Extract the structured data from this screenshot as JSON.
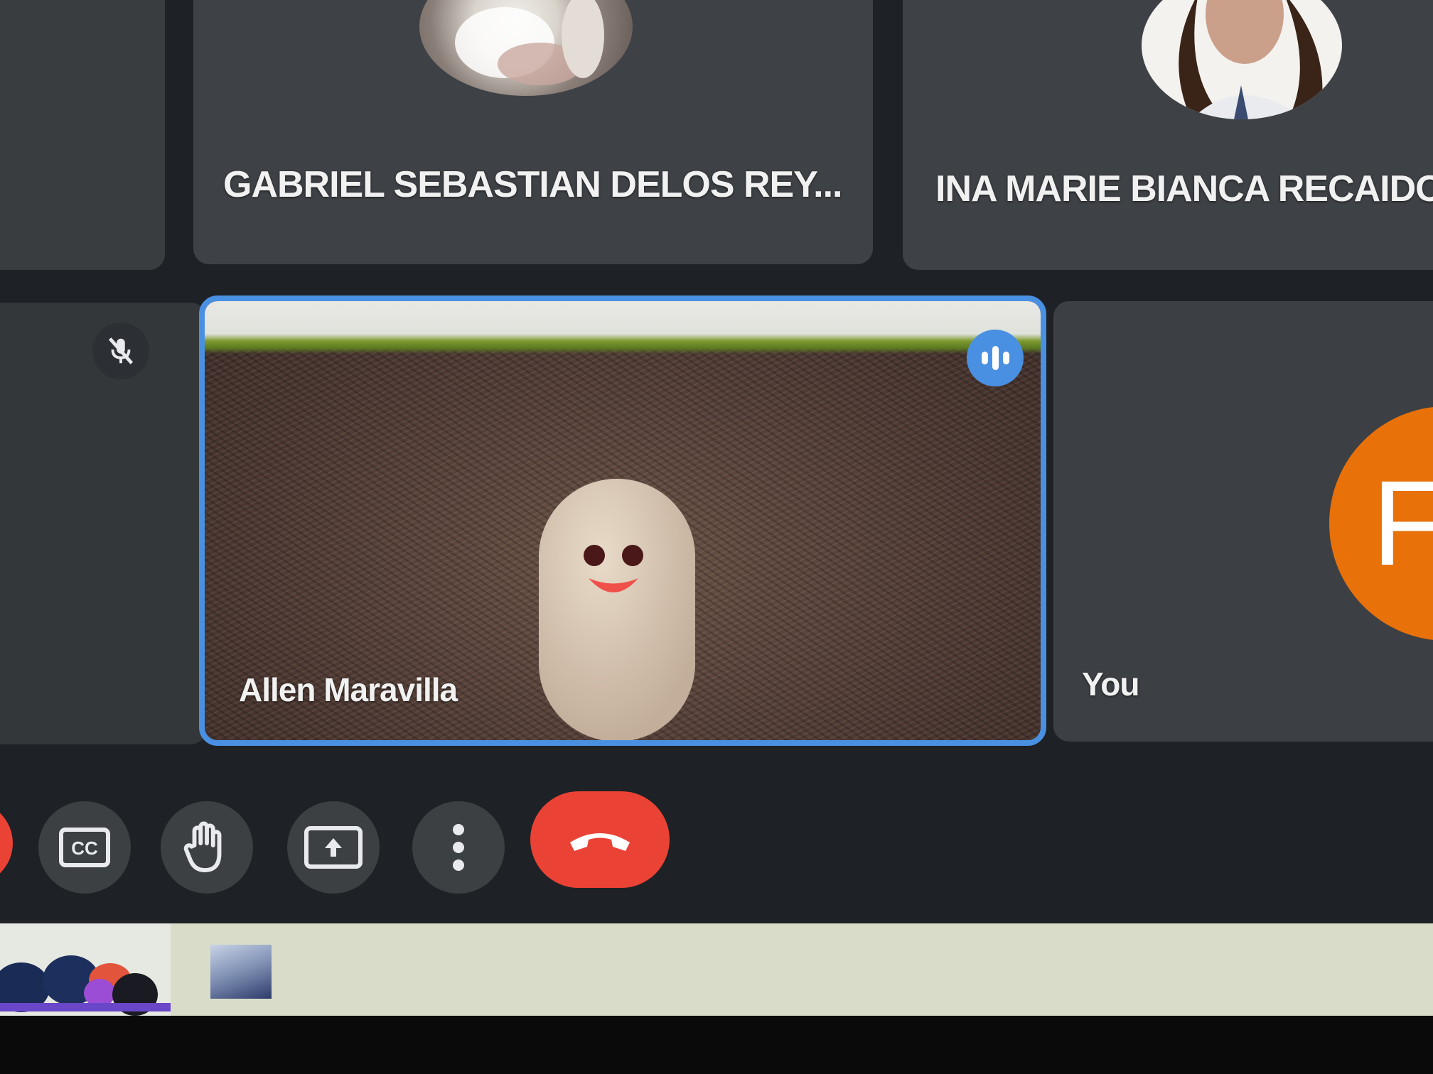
{
  "participants": {
    "gabriel": {
      "name": "GABRIEL SEBASTIAN DELOS REY..."
    },
    "ina": {
      "name": "INA MARIE BIANCA RECAIDO"
    },
    "allen": {
      "name": "Allen Maravilla"
    },
    "self": {
      "name": "You",
      "avatar_initial": "F",
      "avatar_color": "#e8710a"
    }
  },
  "accent_color": "#4a90e2",
  "end_call_color": "#ea4335",
  "controls": [
    {
      "name": "captions-button",
      "icon": "closed-captions-icon",
      "glyph": "CC"
    },
    {
      "name": "raise-hand-button",
      "icon": "hand-icon"
    },
    {
      "name": "present-button",
      "icon": "present-screen-icon"
    },
    {
      "name": "more-options-button",
      "icon": "more-vert-icon"
    },
    {
      "name": "leave-call-button",
      "icon": "call-end-icon"
    }
  ]
}
